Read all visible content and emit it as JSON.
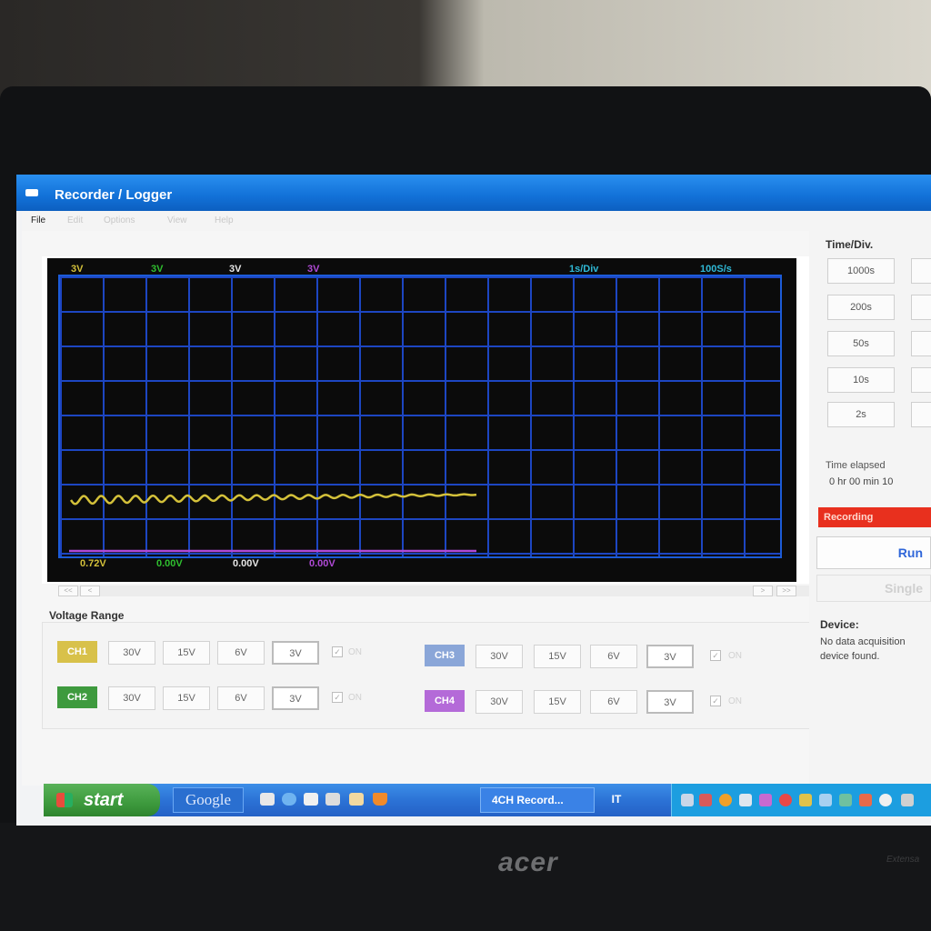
{
  "window": {
    "title": "Recorder / Logger"
  },
  "menu": [
    "File",
    "Edit",
    "Options",
    "View",
    "Help"
  ],
  "scope": {
    "channel_ranges": [
      {
        "text": "3V",
        "color": "#d4c13a"
      },
      {
        "text": "3V",
        "color": "#2fbf2f"
      },
      {
        "text": "3V",
        "color": "#e6e6e6"
      },
      {
        "text": "3V",
        "color": "#b04ad6"
      }
    ],
    "time_div": "1s/Div",
    "sample_rate": "100S/s",
    "channel_values": [
      {
        "text": "0.72V",
        "color": "#d4c13a"
      },
      {
        "text": "0.00V",
        "color": "#2fbf2f"
      },
      {
        "text": "0.00V",
        "color": "#e6e6e6"
      },
      {
        "text": "0.00V",
        "color": "#b04ad6"
      }
    ],
    "trace_color": "#d4c13a",
    "grid_color": "#1d46c2"
  },
  "scroll": {
    "left": "<<",
    "left_small": "<",
    "right_small": ">",
    "right": ">>"
  },
  "voltage_range": {
    "label": "Voltage Range",
    "channels": [
      {
        "name": "CH1",
        "color": "#d8c14a",
        "buttons": [
          "30V",
          "15V",
          "6V"
        ],
        "selected": "3V",
        "on": "ON"
      },
      {
        "name": "CH2",
        "color": "#3e9a3e",
        "buttons": [
          "30V",
          "15V",
          "6V"
        ],
        "selected": "3V",
        "on": "ON"
      },
      {
        "name": "CH3",
        "color": "#8aa6d8",
        "buttons": [
          "30V",
          "15V",
          "6V"
        ],
        "selected": "3V",
        "on": "ON"
      },
      {
        "name": "CH4",
        "color": "#b46ad8",
        "buttons": [
          "30V",
          "15V",
          "6V"
        ],
        "selected": "3V",
        "on": "ON"
      }
    ]
  },
  "time_div_panel": {
    "label": "Time/Div.",
    "buttons": [
      "1000s",
      "200s",
      "50s",
      "10s",
      "2s"
    ]
  },
  "status": {
    "elapsed_label": "Time elapsed",
    "elapsed_value": "0 hr  00 min  10",
    "recording": "Recording",
    "run": "Run",
    "single": "Single"
  },
  "device": {
    "label": "Device:",
    "value": "No data acquisition device found."
  },
  "taskbar": {
    "start": "start",
    "google": "Google",
    "task": "4CH Record...",
    "lang": "IT"
  },
  "laptop": {
    "brand": "acer",
    "model": "Extensa"
  }
}
